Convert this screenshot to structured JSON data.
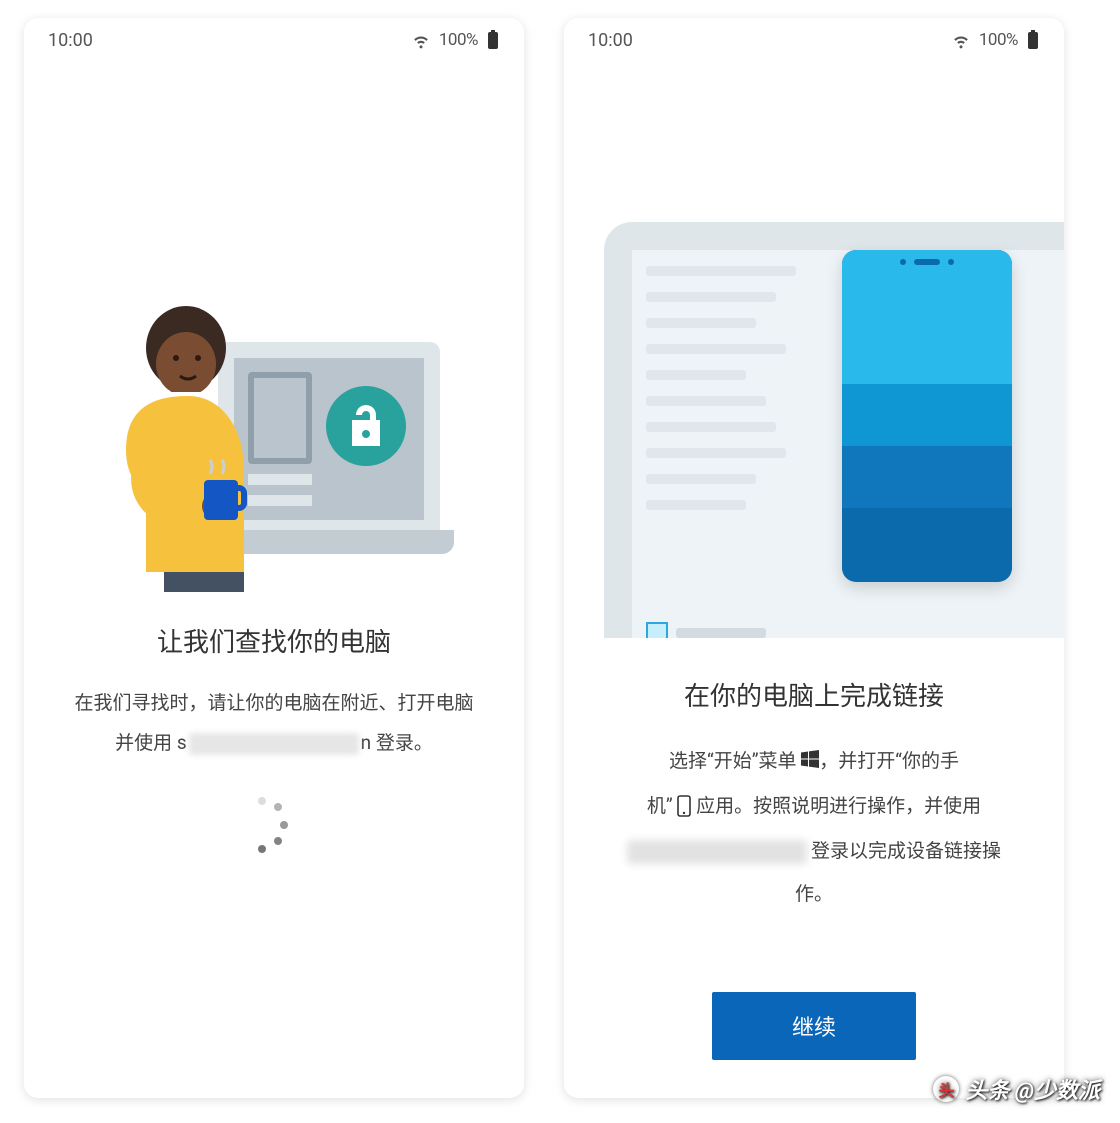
{
  "statusbar": {
    "time": "10:00",
    "battery": "100%"
  },
  "left": {
    "title": "让我们查找你的电脑",
    "desc_pre": "在我们寻找时，请让你的电脑在附近、打开电脑",
    "desc_line2_a": "并使用 s",
    "desc_line2_b": "n 登录。"
  },
  "right": {
    "title": "在你的电脑上完成链接",
    "d_a": "选择“开始”菜单",
    "d_b": "，并打开“你的手",
    "d_c": "机”",
    "d_d": "应用。按照说明进行操作，并使用",
    "d_e": "登录以完成设备链接操",
    "d_f": "作。",
    "continue": "继续"
  },
  "watermark": "头条 @少数派"
}
